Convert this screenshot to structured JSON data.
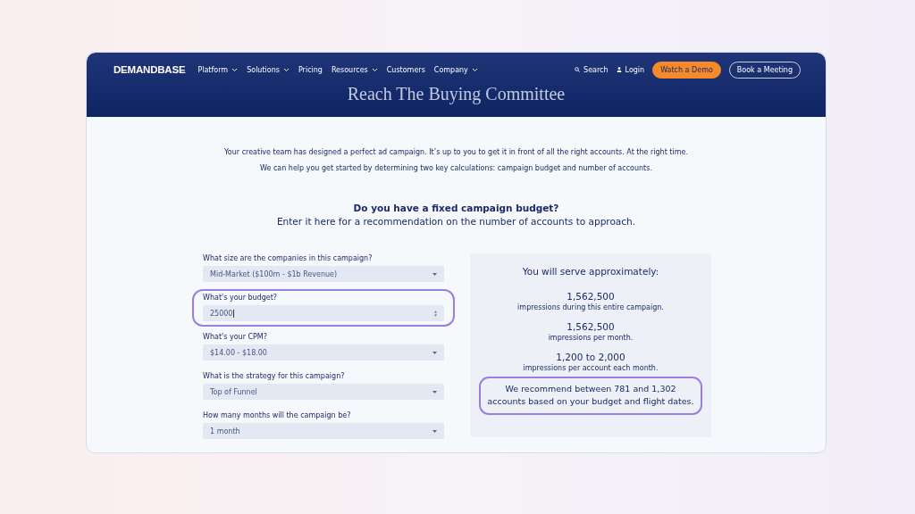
{
  "header": {
    "logo": "DEMANDBASE",
    "overlay_title": "Reach The Buying Committee",
    "nav": [
      {
        "label": "Platform",
        "has_menu": true
      },
      {
        "label": "Solutions",
        "has_menu": true
      },
      {
        "label": "Pricing",
        "has_menu": false
      },
      {
        "label": "Resources",
        "has_menu": true
      },
      {
        "label": "Customers",
        "has_menu": false
      },
      {
        "label": "Company",
        "has_menu": true
      }
    ],
    "search": "Search",
    "login": "Login",
    "buttons": [
      {
        "label": "Watch a Demo",
        "kind": "primary"
      },
      {
        "label": "Book a Meeting",
        "kind": "outline"
      }
    ]
  },
  "intro": [
    "Your creative team has designed a perfect ad campaign. It’s up to you to get it in front of all the right accounts. At the right time.",
    "We can help you get started by determining two key calculations: campaign budget and number of accounts."
  ],
  "heading": "Do you have a fixed campaign budget?",
  "subheading": "Enter it here for a recommendation on the number of accounts to approach.",
  "fields": [
    {
      "label": "What size are the companies in this campaign?",
      "kind": "select",
      "value": "Mid-Market ($100m - $1b Revenue)",
      "highlighted": false
    },
    {
      "label": "What's your budget?",
      "kind": "number",
      "value": "25000",
      "highlighted": true
    },
    {
      "label": "What's your CPM?",
      "kind": "select",
      "value": "$14.00 - $18.00",
      "highlighted": false
    },
    {
      "label": "What is the strategy for this campaign?",
      "kind": "select",
      "value": "Top of Funnel",
      "highlighted": false
    },
    {
      "label": "How many months will the campaign be?",
      "kind": "select",
      "value": "1 month",
      "highlighted": false
    }
  ],
  "results": {
    "title": "You will serve approximately:",
    "stats": [
      {
        "value": "1,562,500",
        "caption": "impressions during this entire campaign."
      },
      {
        "value": "1,562,500",
        "caption": "impressions per month."
      },
      {
        "value": "1,200 to 2,000",
        "caption": "impressions per account each month."
      }
    ],
    "recommendation": {
      "text": "We recommend between 781 and 1,302 accounts based on your budget and flight dates.",
      "highlighted": true
    }
  }
}
